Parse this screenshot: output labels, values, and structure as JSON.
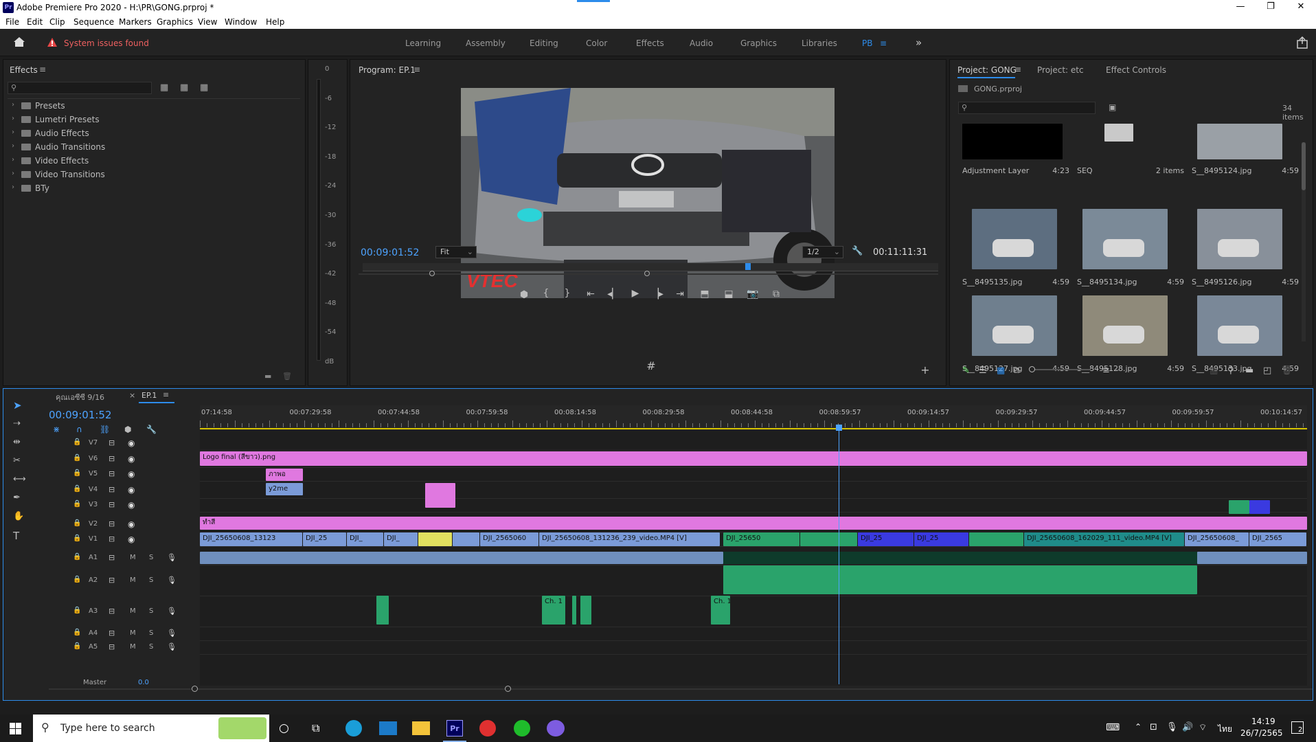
{
  "window": {
    "app_title": "Adobe Premiere Pro 2020 - H:\\PR\\GONG.prproj *",
    "minimize": "—",
    "maximize": "❐",
    "close": "✕"
  },
  "menu": [
    "File",
    "Edit",
    "Clip",
    "Sequence",
    "Markers",
    "Graphics",
    "View",
    "Window",
    "Help"
  ],
  "header": {
    "warning": "System issues found",
    "workspaces": [
      "Learning",
      "Assembly",
      "Editing",
      "Color",
      "Effects",
      "Audio",
      "Graphics",
      "Libraries",
      "PB"
    ],
    "active_workspace": "PB",
    "more": "»"
  },
  "effects_panel": {
    "title": "Effects",
    "items": [
      "Presets",
      "Lumetri Presets",
      "Audio Effects",
      "Audio Transitions",
      "Video Effects",
      "Video Transitions",
      "BTy"
    ]
  },
  "meter": {
    "labels": [
      "0",
      "-6",
      "-12",
      "-18",
      "-24",
      "-30",
      "-36",
      "-42",
      "-48",
      "-54",
      "dB"
    ]
  },
  "program": {
    "title": "Program: EP.1",
    "timecode": "00:09:01:52",
    "fit": "Fit",
    "resolution": "1/2",
    "duration": "00:11:11:31",
    "playhead_fraction": 0.67
  },
  "project": {
    "tabs": [
      "Project: GONG",
      "Project: etc",
      "Effect Controls"
    ],
    "file": "GONG.prproj",
    "count": "34 items",
    "items": [
      {
        "name": "Adjustment Layer",
        "dur": "4:23",
        "kind": "black"
      },
      {
        "name": "SEQ",
        "dur": "2 items",
        "kind": "bin"
      },
      {
        "name": "S__8495124.jpg",
        "dur": "4:59",
        "kind": "photo"
      },
      {
        "name": "S__8495135.jpg",
        "dur": "4:59",
        "kind": "photo"
      },
      {
        "name": "S__8495134.jpg",
        "dur": "4:59",
        "kind": "photo"
      },
      {
        "name": "S__8495126.jpg",
        "dur": "4:59",
        "kind": "photo"
      },
      {
        "name": "S__8495127.jpg",
        "dur": "4:59",
        "kind": "photo"
      },
      {
        "name": "S__8495128.jpg",
        "dur": "4:59",
        "kind": "photo"
      },
      {
        "name": "S__8495133.jpg",
        "dur": "4:59",
        "kind": "photo"
      }
    ]
  },
  "timeline": {
    "tabs": [
      "คุณเอซีซี 9/16",
      "EP.1"
    ],
    "timecode": "00:09:01:52",
    "ticks": [
      "07:14:58",
      "00:07:29:58",
      "00:07:44:58",
      "00:07:59:58",
      "00:08:14:58",
      "00:08:29:58",
      "00:08:44:58",
      "00:08:59:57",
      "00:09:14:57",
      "00:09:29:57",
      "00:09:44:57",
      "00:09:59:57",
      "00:10:14:57"
    ],
    "video_tracks": [
      "V7",
      "V6",
      "V5",
      "V4",
      "V3",
      "V2",
      "V1"
    ],
    "audio_tracks": [
      "A1",
      "A2",
      "A3",
      "A4",
      "A5"
    ],
    "master": "Master",
    "master_val": "0.0",
    "clips": {
      "logo": "Logo final (สีขาว).png",
      "v5": "ภาพอ",
      "v4": "y2me",
      "v2": "ทำสี",
      "v1a": "DJI_25650608_13123",
      "v1b": "DJI_25",
      "v1c": "DJI_",
      "v1d": "DJI_",
      "v1e": "DJI_2565060",
      "v1f": "DJI_25650608_131236_239_video.MP4 [V]",
      "v1g": "DJI_25650",
      "v1h": "DJI_25",
      "v1i": "DJI_25",
      "v1j": "DJI_25650608_162029_111_video.MP4 [V]",
      "v1k": "DJI_25650608_",
      "v1l": "DJI_2565",
      "ch": "Ch. 1"
    },
    "m": "M",
    "s": "S"
  },
  "taskbar": {
    "search_placeholder": "Type here to search",
    "time": "14:19",
    "date": "26/7/2565",
    "lang": "ไทย",
    "notif": "2"
  },
  "colors": {
    "pink": "#e078e0",
    "blue": "#7b9bd8",
    "green": "#2aa36b",
    "accent": "#2d8ceb"
  }
}
